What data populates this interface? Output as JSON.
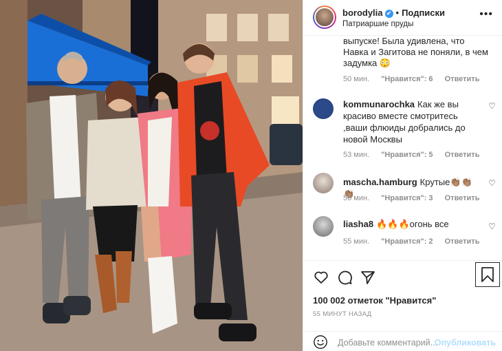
{
  "header": {
    "username": "borodylia",
    "verified_mark": "✔",
    "separator": "•",
    "follow_label": "Подписки",
    "location": "Патриаршие пруды",
    "more_icon": "more-horizontal-icon"
  },
  "photo": {
    "description_icon": "post-photo"
  },
  "first_comment": {
    "text": "выпуске! Была удивлена, что Навка и Загитова не поняли, в чем задумка 😳",
    "time": "50 мин.",
    "likes": "\"Нравится\": 6",
    "reply": "Ответить"
  },
  "comments": [
    {
      "user": "kommunarochka",
      "text": "Как же вы красиво вместе смотритесь ,ваши флюиды добрались до новой Москвы",
      "time": "53 мин.",
      "likes": "\"Нравится\": 5",
      "reply": "Ответить"
    },
    {
      "user": "mascha.hamburg",
      "text": "Крутые👏🏽👏🏽👏🏽",
      "time": "56 мин.",
      "likes": "\"Нравится\": 3",
      "reply": "Ответить"
    },
    {
      "user": "liasha8",
      "text": "🔥🔥🔥огонь все",
      "time": "55 мин.",
      "likes": "\"Нравится\": 2",
      "reply": "Ответить"
    }
  ],
  "actions": {
    "likes_text": "100 002 отметок \"Нравится\"",
    "time_ago": "55 МИНУТ НАЗАД"
  },
  "add_comment": {
    "placeholder": "Добавьте комментарий...",
    "publish": "Опубликовать"
  }
}
